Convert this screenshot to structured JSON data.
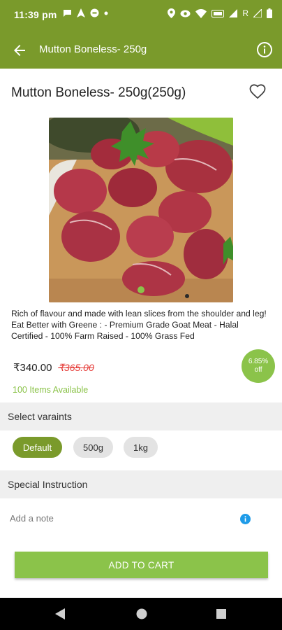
{
  "status_bar": {
    "time": "11:39 pm",
    "carrier_letter": "R",
    "icons": [
      "chat-bubble-icon",
      "navigation-icon",
      "circle-badge-icon",
      "dot-icon",
      "location-icon",
      "eye-icon",
      "wifi-icon",
      "volte-icon",
      "signal-icon",
      "battery-icon"
    ]
  },
  "app_bar": {
    "title": "Mutton Boneless- 250g",
    "color": "#7a9a2b"
  },
  "product": {
    "title": "Mutton Boneless- 250g(250g)",
    "description": "Rich of flavour and made with lean slices from the shoulder and leg! Eat Better with Greene : - Premium Grade Goat Meat - Halal Certified - 100% Farm Raised - 100% Grass Fed",
    "price": "₹340.00",
    "old_price": "₹365.00",
    "discount_value": "6.85%",
    "discount_label": "off",
    "stock": "100 Items Available",
    "accent_color": "#8bc34a"
  },
  "variants": {
    "header": "Select varaints",
    "options": [
      "Default",
      "500g",
      "1kg"
    ],
    "selected": "Default"
  },
  "instruction": {
    "header": "Special Instruction",
    "placeholder": "Add a note"
  },
  "cart": {
    "button_label": "ADD TO CART"
  }
}
